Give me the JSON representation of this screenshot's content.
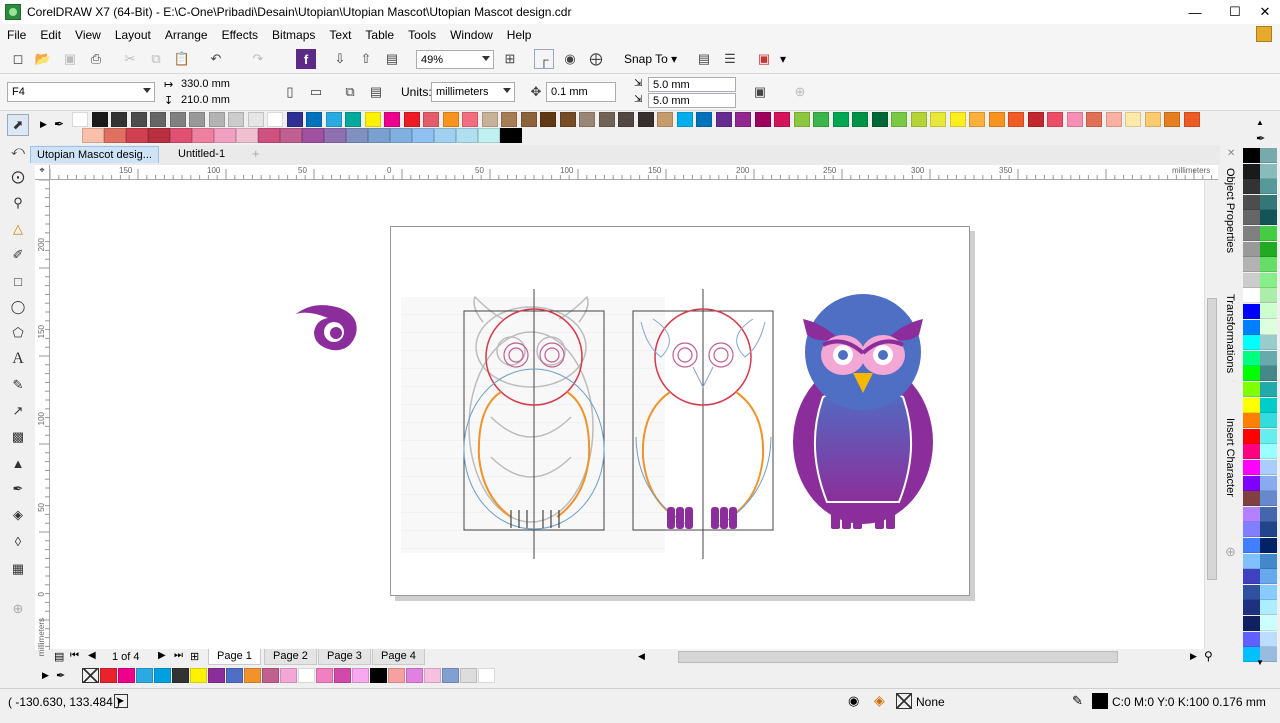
{
  "window": {
    "title": "CorelDRAW X7 (64-Bit) - E:\\C-One\\Pribadi\\Desain\\Utopian\\Utopian Mascot\\Utopian Mascot design.cdr",
    "minimize": "—",
    "maximize": "☐",
    "close": "✕"
  },
  "menu": [
    "File",
    "Edit",
    "View",
    "Layout",
    "Arrange",
    "Effects",
    "Bitmaps",
    "Text",
    "Table",
    "Tools",
    "Window",
    "Help"
  ],
  "toolbar": {
    "zoom": "49%",
    "snap_to": "Snap To"
  },
  "propertybar": {
    "page_size": "F4",
    "width": "330.0 mm",
    "height": "210.0 mm",
    "units_label": "Units:",
    "units": "millimeters",
    "nudge": "0.1 mm",
    "dup_x": "5.0 mm",
    "dup_y": "5.0 mm"
  },
  "doc_tabs": [
    "Utopian Mascot desig...",
    "Untitled-1"
  ],
  "rulers": {
    "unit": "millimeters",
    "h_ticks": [
      "150",
      "100",
      "50",
      "0",
      "50",
      "100",
      "150",
      "200",
      "250",
      "300",
      "350"
    ],
    "v_ticks": [
      "200",
      "150",
      "100",
      "50",
      "0"
    ]
  },
  "dockers": [
    "Object Properties",
    "Transformations",
    "Insert Character"
  ],
  "pages": {
    "indicator": "1 of 4",
    "tabs": [
      "Page 1",
      "Page 2",
      "Page 3",
      "Page 4"
    ]
  },
  "status": {
    "coords": "( -130.630, 133.484 )",
    "fill": "None",
    "outline": "C:0 M:0 Y:0 K:100  0.176 mm"
  },
  "colors": {
    "purple": "#8b2e9b",
    "blue": "#4f6fc4",
    "pink": "#f2a7d5",
    "guide_red": "#d63a4a",
    "guide_orange": "#f0932b"
  }
}
